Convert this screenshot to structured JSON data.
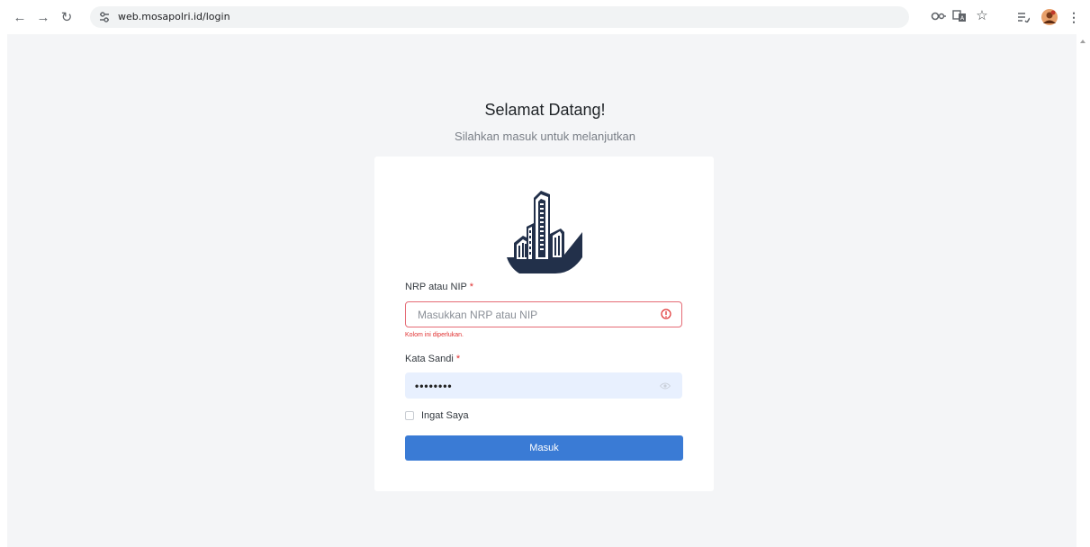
{
  "browser": {
    "url": "web.mosapolri.id/login",
    "icons": [
      "back-icon",
      "forward-icon",
      "reload-icon",
      "site-settings-icon",
      "password-key-icon",
      "translate-icon",
      "bookmark-star-icon",
      "reading-list-icon",
      "profile-avatar-icon",
      "menu-kebab-icon"
    ]
  },
  "page": {
    "title": "Selamat Datang!",
    "subtitle": "Silahkan masuk untuk melanjutkan",
    "background": "#f4f5f7"
  },
  "form": {
    "nrp_label": "NRP atau NIP",
    "required_mark": "*",
    "nrp_placeholder": "Masukkan NRP atau NIP",
    "nrp_error": "Kolom ini diperlukan.",
    "password_label": "Kata Sandi",
    "password_value": "••••••••",
    "remember_label": "Ingat Saya",
    "remember_checked": false,
    "submit_label": "Masuk",
    "accent": "#3a7bd5",
    "error_color": "#e03131"
  }
}
